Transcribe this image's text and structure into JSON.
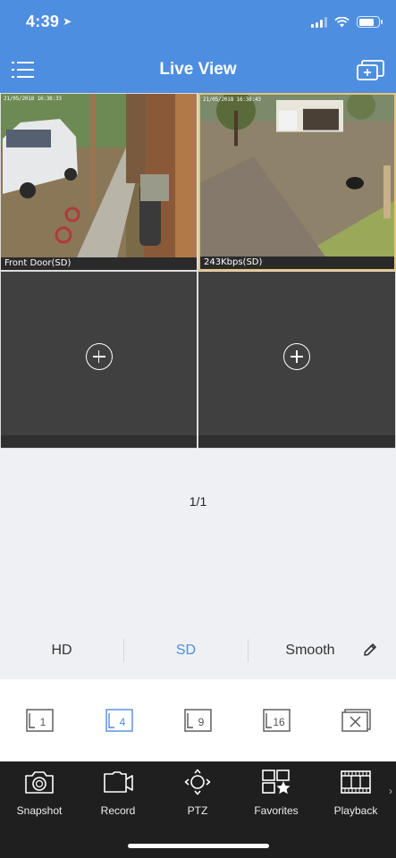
{
  "status_bar": {
    "time": "4:39"
  },
  "nav": {
    "title": "Live View"
  },
  "cameras": [
    {
      "label": "Front Door(SD)",
      "osd": "21/05/2018 16:38:33"
    },
    {
      "label": "243Kbps(SD)",
      "osd": "21/05/2018 16:38:43"
    }
  ],
  "page_indicator": "1/1",
  "quality_options": [
    "HD",
    "SD",
    "Smooth"
  ],
  "quality_selected": "SD",
  "layout_options": [
    "1",
    "4",
    "9",
    "16"
  ],
  "layout_selected": "4",
  "toolbar": [
    "Snapshot",
    "Record",
    "PTZ",
    "Favorites",
    "Playback"
  ],
  "colors": {
    "header": "#4e8ee0",
    "accent": "#4e8ee0",
    "selected_frame": "#e7c37a"
  }
}
